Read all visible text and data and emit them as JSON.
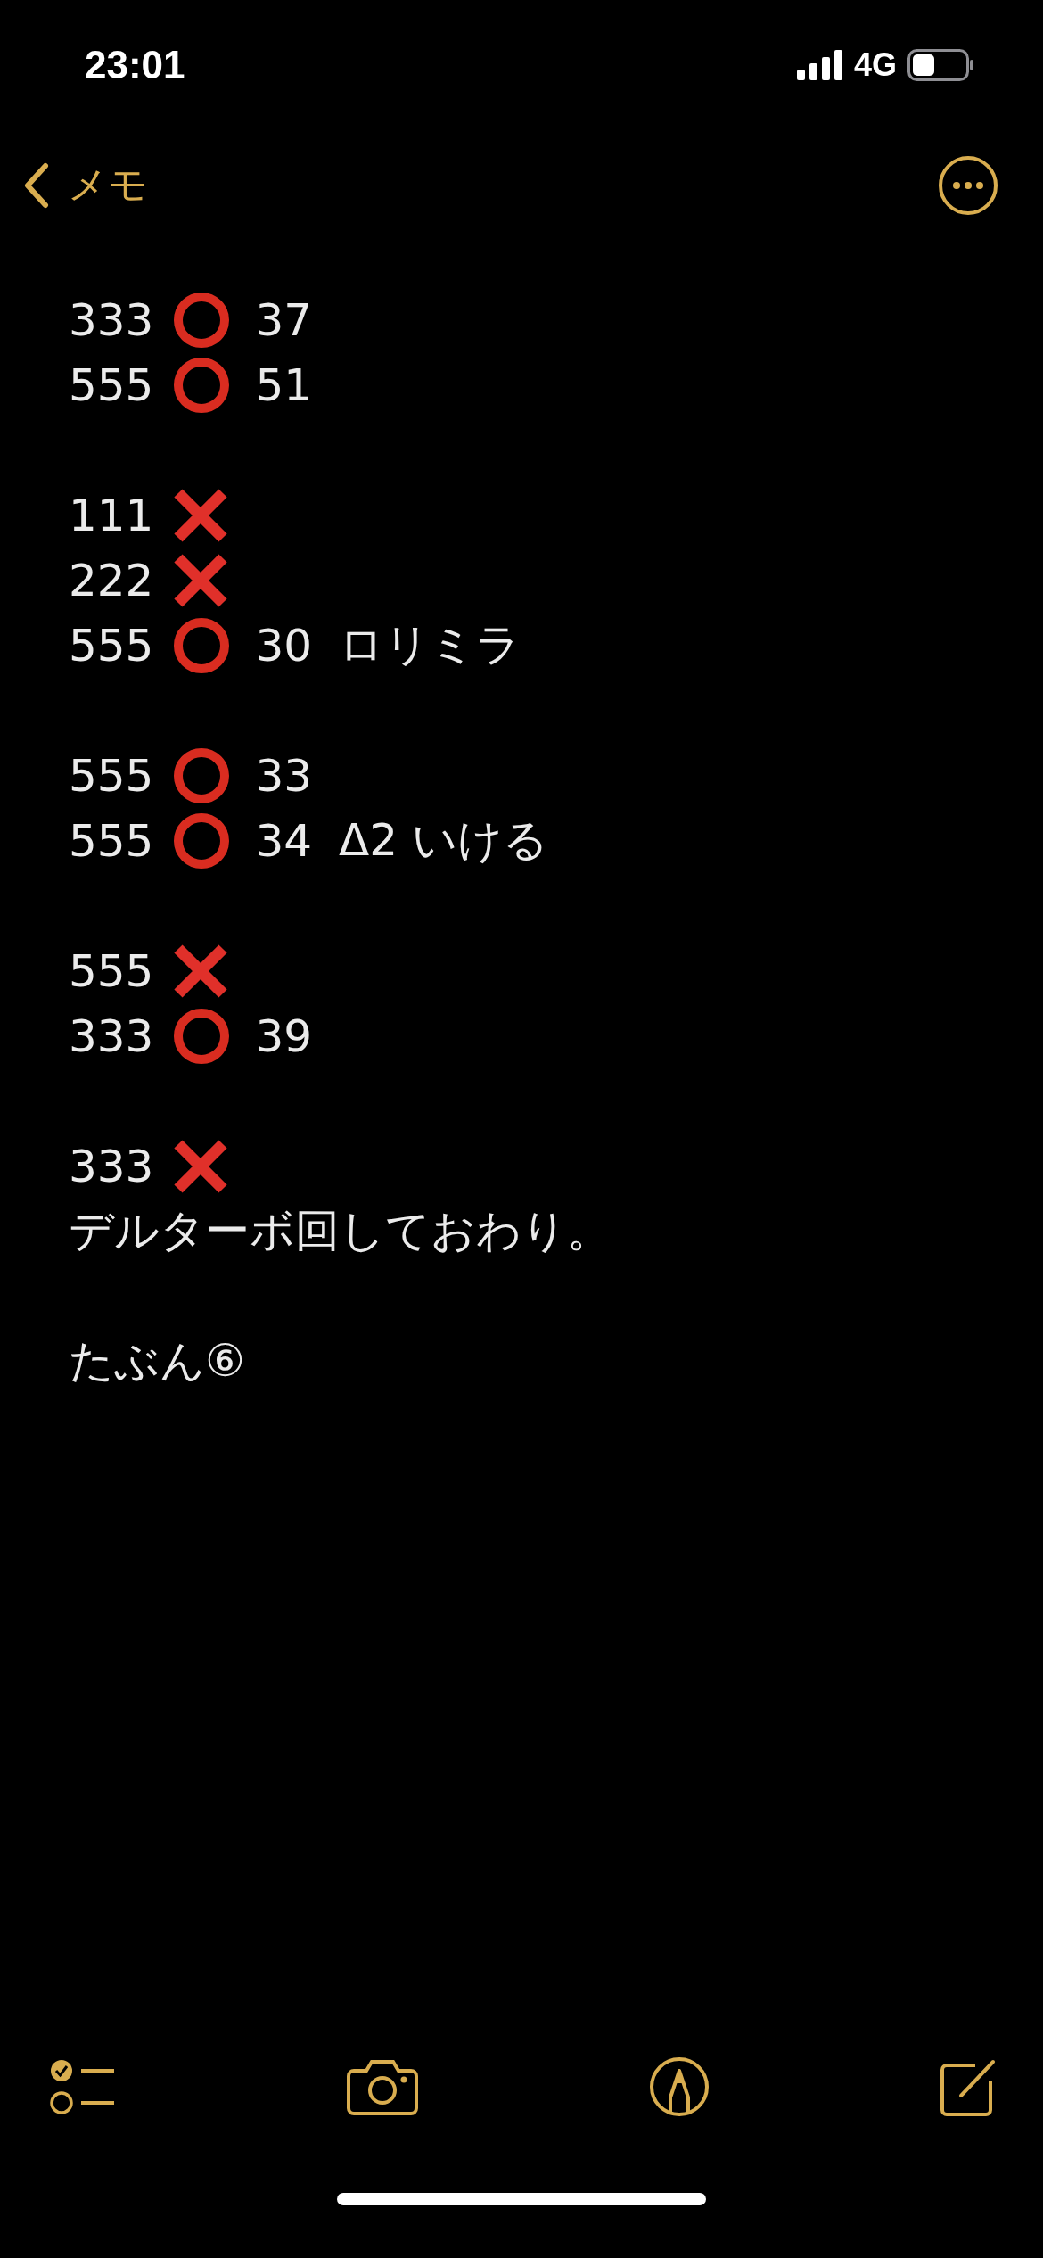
{
  "status_bar": {
    "time": "23:01",
    "network": "4G"
  },
  "nav": {
    "back_label": "メモ"
  },
  "groups": [
    {
      "lines": [
        {
          "kind": "entry",
          "number": "333",
          "hit": true,
          "value": "37"
        },
        {
          "kind": "entry",
          "number": "555",
          "hit": true,
          "value": "51"
        }
      ]
    },
    {
      "lines": [
        {
          "kind": "entry",
          "number": "111",
          "hit": false
        },
        {
          "kind": "entry",
          "number": "222",
          "hit": false
        },
        {
          "kind": "entry",
          "number": "555",
          "hit": true,
          "value": "30",
          "note": "ロリミラ"
        }
      ]
    },
    {
      "lines": [
        {
          "kind": "entry",
          "number": "555",
          "hit": true,
          "value": "33"
        },
        {
          "kind": "entry",
          "number": "555",
          "hit": true,
          "value": "34",
          "note": "Δ2 いける"
        }
      ]
    },
    {
      "lines": [
        {
          "kind": "entry",
          "number": "555",
          "hit": false
        },
        {
          "kind": "entry",
          "number": "333",
          "hit": true,
          "value": "39"
        }
      ]
    },
    {
      "lines": [
        {
          "kind": "entry",
          "number": "333",
          "hit": false
        },
        {
          "kind": "text",
          "text": "デルターボ回しておわり。"
        }
      ]
    },
    {
      "lines": [
        {
          "kind": "text",
          "text": "たぶん⑥"
        }
      ]
    }
  ]
}
